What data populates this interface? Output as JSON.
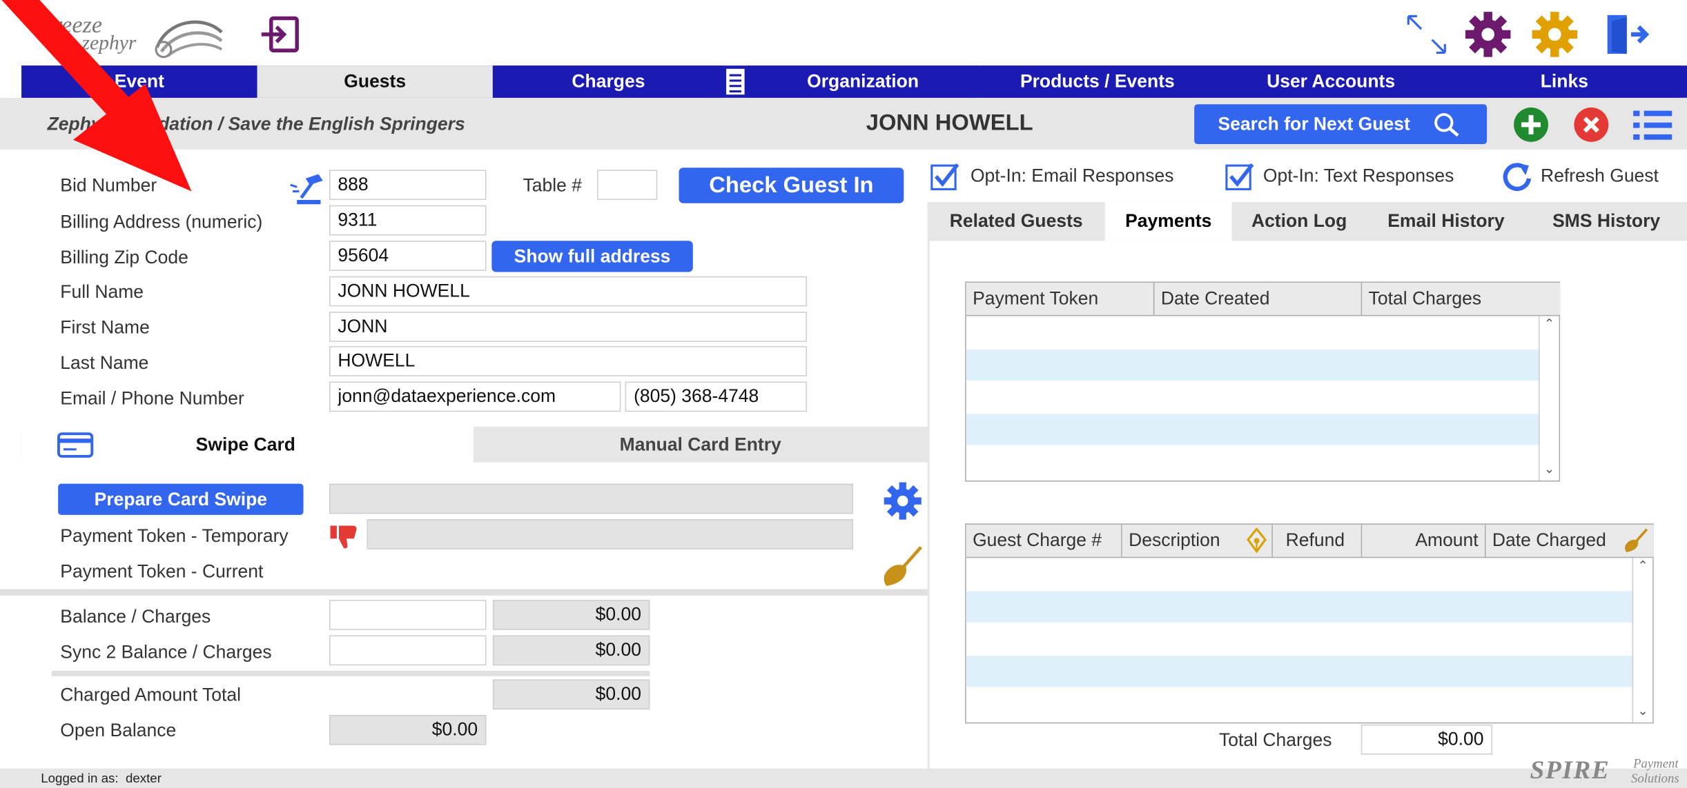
{
  "logo": {
    "line1": "Breeze",
    "line2": "zephyr"
  },
  "nav": {
    "tabs": [
      {
        "label": "Event"
      },
      {
        "label": "Guests"
      },
      {
        "label": "Charges"
      },
      {
        "label": "Organization"
      },
      {
        "label": "Products / Events"
      },
      {
        "label": "User Accounts"
      },
      {
        "label": "Links"
      }
    ]
  },
  "header": {
    "breadcrumb": "Zephyr Foundation / Save the English Springers",
    "guest_name": "JONN HOWELL",
    "search_button": "Search for Next Guest"
  },
  "form": {
    "bid_number_label": "Bid Number",
    "bid_number": "888",
    "table_label": "Table #",
    "table_value": "",
    "check_in_button": "Check Guest In",
    "billing_address_label": "Billing Address (numeric)",
    "billing_address": "9311",
    "billing_zip_label": "Billing Zip Code",
    "billing_zip": "95604",
    "show_address_button": "Show full address",
    "full_name_label": "Full Name",
    "full_name": "JONN HOWELL",
    "first_name_label": "First Name",
    "first_name": "JONN",
    "last_name_label": "Last Name",
    "last_name": "HOWELL",
    "email_phone_label": "Email / Phone Number",
    "email": "jonn@dataexperience.com",
    "phone": "(805) 368-4748"
  },
  "card": {
    "tabs": [
      {
        "label": "Swipe Card"
      },
      {
        "label": "Manual Card Entry"
      }
    ],
    "prepare_button": "Prepare Card Swipe",
    "token_temp_label": "Payment Token - Temporary",
    "token_current_label": "Payment Token - Current"
  },
  "balances": {
    "balance_label": "Balance / Charges",
    "balance_value": "$0.00",
    "sync_label": "Sync 2 Balance / Charges",
    "sync_value": "$0.00",
    "charged_total_label": "Charged Amount Total",
    "charged_total_value": "$0.00",
    "open_balance_label": "Open Balance",
    "open_balance_value": "$0.00"
  },
  "options": {
    "email_optin": "Opt-In: Email Responses",
    "text_optin": "Opt-In: Text Responses",
    "refresh": "Refresh Guest"
  },
  "right_tabs": [
    {
      "label": "Related Guests"
    },
    {
      "label": "Payments"
    },
    {
      "label": "Action Log"
    },
    {
      "label": "Email History"
    },
    {
      "label": "SMS History"
    }
  ],
  "payments_table": {
    "columns": [
      "Payment Token",
      "Date Created",
      "Total Charges"
    ]
  },
  "charges_table": {
    "columns": [
      "Guest Charge #",
      "Description",
      "Refund",
      "Amount",
      "Date Charged"
    ],
    "total_label": "Total Charges",
    "total_value": "$0.00"
  },
  "footer": {
    "logged_in": "Logged in as:  dexter",
    "brand_main": "SPIRE",
    "brand_sub1": "Payment",
    "brand_sub2": "Solutions"
  },
  "colors": {
    "nav_blue": "#1b1bb4",
    "button_blue": "#3366ee",
    "add_green": "#1f8a2e",
    "cancel_red": "#e53935",
    "gear_purple": "#6d1a6e",
    "gear_gold": "#e0a000",
    "row_tint": "#dff0fb"
  }
}
